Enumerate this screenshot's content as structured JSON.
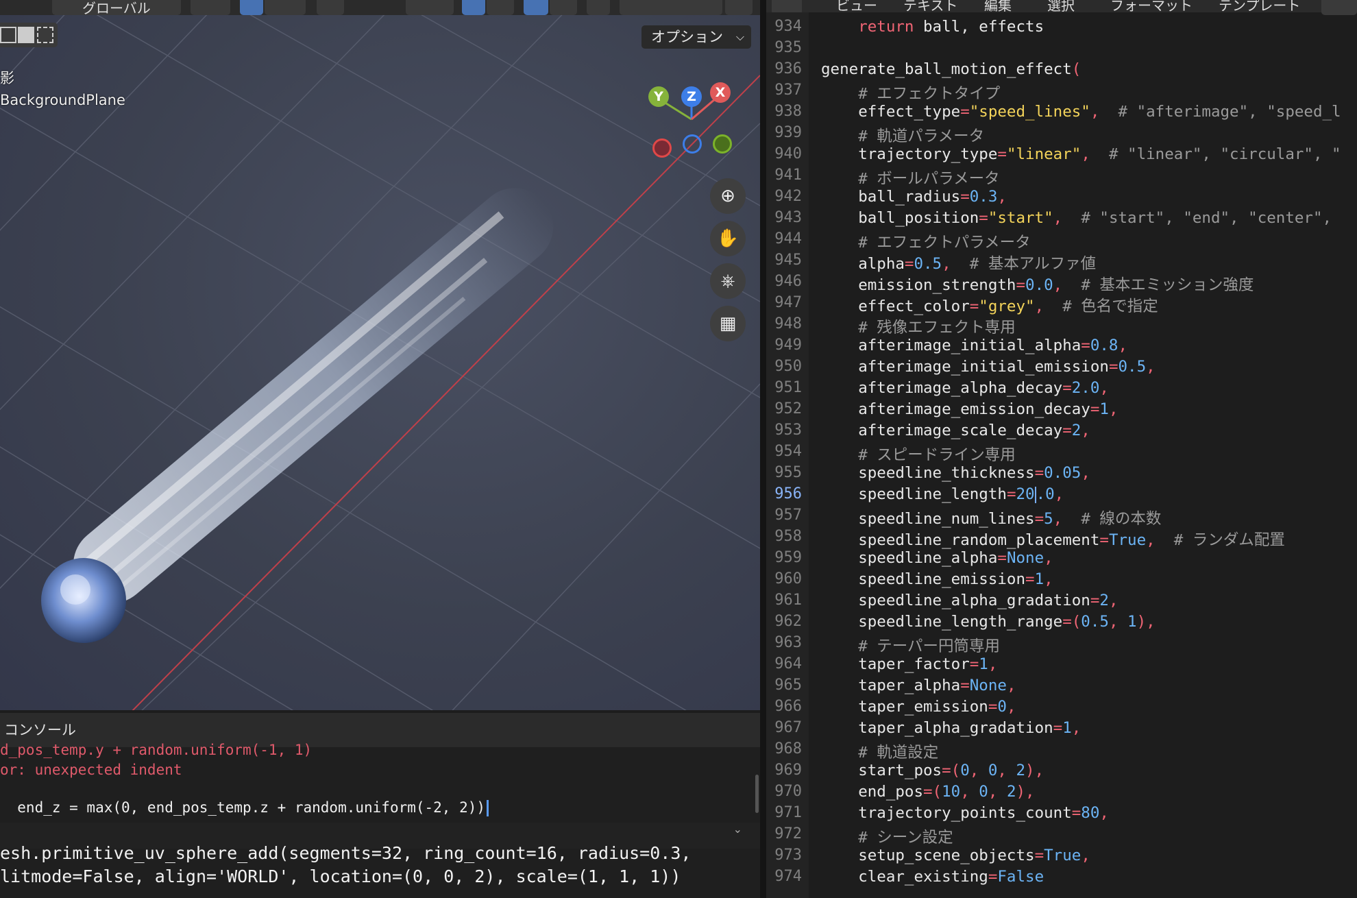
{
  "viewport": {
    "header_mode_label": "グローバル",
    "options_label": "オプション",
    "view_info_line1": "影",
    "view_info_line2": "BackgroundPlane",
    "gizmo": {
      "x": "X",
      "y": "Y",
      "z": "Z"
    },
    "colors": {
      "x_axis": "#e05a5a",
      "y_axis": "#86b33b",
      "z_axis": "#3d7ee8",
      "x_ring": "#e04848",
      "y_ring": "#7cb32a"
    },
    "tools": [
      "zoom-icon",
      "hand-pan-icon",
      "camera-icon",
      "grid-icon"
    ]
  },
  "console": {
    "title": "コンソール",
    "lines": [
      {
        "text": "d_pos_temp.y + random.uniform(-1, 1)",
        "type": "error"
      },
      {
        "text": "or: unexpected indent",
        "type": "error"
      },
      {
        "text": "  end_z = max(0, end_pos_temp.z + random.uniform(-2, 2))",
        "type": "input"
      }
    ],
    "output": [
      "esh.primitive_uv_sphere_add(segments=32, ring_count=16, radius=0.3,",
      "litmode=False, align='WORLD', location=(0, 0, 2), scale=(1, 1, 1))"
    ]
  },
  "editor": {
    "menus": [
      "ビュー",
      "テキスト",
      "編集",
      "選択",
      "フォーマット",
      "テンプレート"
    ],
    "current_line": 956,
    "lines": [
      {
        "n": 934,
        "tokens": [
          [
            "i",
            "    "
          ],
          [
            "kw",
            "return"
          ],
          [
            "t",
            " ball, effects"
          ]
        ]
      },
      {
        "n": 935,
        "tokens": []
      },
      {
        "n": 936,
        "tokens": [
          [
            "t",
            "generate_ball_motion_effect"
          ],
          [
            "op",
            "("
          ]
        ]
      },
      {
        "n": 937,
        "tokens": [
          [
            "i",
            "    "
          ],
          [
            "com",
            "# エフェクトタイプ"
          ]
        ]
      },
      {
        "n": 938,
        "tokens": [
          [
            "i",
            "    "
          ],
          [
            "t",
            "effect_type"
          ],
          [
            "op",
            "="
          ],
          [
            "str",
            "\"speed_lines\""
          ],
          [
            "op",
            ","
          ],
          [
            "t",
            "  "
          ],
          [
            "com",
            "# \"afterimage\", \"speed_l"
          ]
        ]
      },
      {
        "n": 939,
        "tokens": [
          [
            "i",
            "    "
          ],
          [
            "com",
            "# 軌道パラメータ"
          ]
        ]
      },
      {
        "n": 940,
        "tokens": [
          [
            "i",
            "    "
          ],
          [
            "t",
            "trajectory_type"
          ],
          [
            "op",
            "="
          ],
          [
            "str",
            "\"linear\""
          ],
          [
            "op",
            ","
          ],
          [
            "t",
            "  "
          ],
          [
            "com",
            "# \"linear\", \"circular\", \""
          ]
        ]
      },
      {
        "n": 941,
        "tokens": [
          [
            "i",
            "    "
          ],
          [
            "com",
            "# ボールパラメータ"
          ]
        ]
      },
      {
        "n": 942,
        "tokens": [
          [
            "i",
            "    "
          ],
          [
            "t",
            "ball_radius"
          ],
          [
            "op",
            "="
          ],
          [
            "num",
            "0.3"
          ],
          [
            "op",
            ","
          ]
        ]
      },
      {
        "n": 943,
        "tokens": [
          [
            "i",
            "    "
          ],
          [
            "t",
            "ball_position"
          ],
          [
            "op",
            "="
          ],
          [
            "str",
            "\"start\""
          ],
          [
            "op",
            ","
          ],
          [
            "t",
            "  "
          ],
          [
            "com",
            "# \"start\", \"end\", \"center\","
          ]
        ]
      },
      {
        "n": 944,
        "tokens": [
          [
            "i",
            "    "
          ],
          [
            "com",
            "# エフェクトパラメータ"
          ]
        ]
      },
      {
        "n": 945,
        "tokens": [
          [
            "i",
            "    "
          ],
          [
            "t",
            "alpha"
          ],
          [
            "op",
            "="
          ],
          [
            "num",
            "0.5"
          ],
          [
            "op",
            ","
          ],
          [
            "t",
            "  "
          ],
          [
            "com",
            "# 基本アルファ値"
          ]
        ]
      },
      {
        "n": 946,
        "tokens": [
          [
            "i",
            "    "
          ],
          [
            "t",
            "emission_strength"
          ],
          [
            "op",
            "="
          ],
          [
            "num",
            "0.0"
          ],
          [
            "op",
            ","
          ],
          [
            "t",
            "  "
          ],
          [
            "com",
            "# 基本エミッション強度"
          ]
        ]
      },
      {
        "n": 947,
        "tokens": [
          [
            "i",
            "    "
          ],
          [
            "t",
            "effect_color"
          ],
          [
            "op",
            "="
          ],
          [
            "str",
            "\"grey\""
          ],
          [
            "op",
            ","
          ],
          [
            "t",
            "  "
          ],
          [
            "com",
            "# 色名で指定"
          ]
        ]
      },
      {
        "n": 948,
        "tokens": [
          [
            "i",
            "    "
          ],
          [
            "com",
            "# 残像エフェクト専用"
          ]
        ]
      },
      {
        "n": 949,
        "tokens": [
          [
            "i",
            "    "
          ],
          [
            "t",
            "afterimage_initial_alpha"
          ],
          [
            "op",
            "="
          ],
          [
            "num",
            "0.8"
          ],
          [
            "op",
            ","
          ]
        ]
      },
      {
        "n": 950,
        "tokens": [
          [
            "i",
            "    "
          ],
          [
            "t",
            "afterimage_initial_emission"
          ],
          [
            "op",
            "="
          ],
          [
            "num",
            "0.5"
          ],
          [
            "op",
            ","
          ]
        ]
      },
      {
        "n": 951,
        "tokens": [
          [
            "i",
            "    "
          ],
          [
            "t",
            "afterimage_alpha_decay"
          ],
          [
            "op",
            "="
          ],
          [
            "num",
            "2.0"
          ],
          [
            "op",
            ","
          ]
        ]
      },
      {
        "n": 952,
        "tokens": [
          [
            "i",
            "    "
          ],
          [
            "t",
            "afterimage_emission_decay"
          ],
          [
            "op",
            "="
          ],
          [
            "num",
            "1"
          ],
          [
            "op",
            ","
          ]
        ]
      },
      {
        "n": 953,
        "tokens": [
          [
            "i",
            "    "
          ],
          [
            "t",
            "afterimage_scale_decay"
          ],
          [
            "op",
            "="
          ],
          [
            "num",
            "2"
          ],
          [
            "op",
            ","
          ]
        ]
      },
      {
        "n": 954,
        "tokens": [
          [
            "i",
            "    "
          ],
          [
            "com",
            "# スピードライン専用"
          ]
        ]
      },
      {
        "n": 955,
        "tokens": [
          [
            "i",
            "    "
          ],
          [
            "t",
            "speedline_thickness"
          ],
          [
            "op",
            "="
          ],
          [
            "num",
            "0.05"
          ],
          [
            "op",
            ","
          ]
        ]
      },
      {
        "n": 956,
        "tokens": [
          [
            "i",
            "    "
          ],
          [
            "t",
            "speedline_length"
          ],
          [
            "op",
            "="
          ],
          [
            "num",
            "20"
          ],
          [
            "cursor",
            ""
          ],
          [
            "num",
            ".0"
          ],
          [
            "op",
            ","
          ]
        ]
      },
      {
        "n": 957,
        "tokens": [
          [
            "i",
            "    "
          ],
          [
            "t",
            "speedline_num_lines"
          ],
          [
            "op",
            "="
          ],
          [
            "num",
            "5"
          ],
          [
            "op",
            ","
          ],
          [
            "t",
            "  "
          ],
          [
            "com",
            "# 線の本数"
          ]
        ]
      },
      {
        "n": 958,
        "tokens": [
          [
            "i",
            "    "
          ],
          [
            "t",
            "speedline_random_placement"
          ],
          [
            "op",
            "="
          ],
          [
            "num",
            "True"
          ],
          [
            "op",
            ","
          ],
          [
            "t",
            "  "
          ],
          [
            "com",
            "# ランダム配置"
          ]
        ]
      },
      {
        "n": 959,
        "tokens": [
          [
            "i",
            "    "
          ],
          [
            "t",
            "speedline_alpha"
          ],
          [
            "op",
            "="
          ],
          [
            "num",
            "None"
          ],
          [
            "op",
            ","
          ]
        ]
      },
      {
        "n": 960,
        "tokens": [
          [
            "i",
            "    "
          ],
          [
            "t",
            "speedline_emission"
          ],
          [
            "op",
            "="
          ],
          [
            "num",
            "1"
          ],
          [
            "op",
            ","
          ]
        ]
      },
      {
        "n": 961,
        "tokens": [
          [
            "i",
            "    "
          ],
          [
            "t",
            "speedline_alpha_gradation"
          ],
          [
            "op",
            "="
          ],
          [
            "num",
            "2"
          ],
          [
            "op",
            ","
          ]
        ]
      },
      {
        "n": 962,
        "tokens": [
          [
            "i",
            "    "
          ],
          [
            "t",
            "speedline_length_range"
          ],
          [
            "op",
            "=("
          ],
          [
            "num",
            "0.5"
          ],
          [
            "op",
            ", "
          ],
          [
            "num",
            "1"
          ],
          [
            "op",
            "),"
          ]
        ]
      },
      {
        "n": 963,
        "tokens": [
          [
            "i",
            "    "
          ],
          [
            "com",
            "# テーパー円筒専用"
          ]
        ]
      },
      {
        "n": 964,
        "tokens": [
          [
            "i",
            "    "
          ],
          [
            "t",
            "taper_factor"
          ],
          [
            "op",
            "="
          ],
          [
            "num",
            "1"
          ],
          [
            "op",
            ","
          ]
        ]
      },
      {
        "n": 965,
        "tokens": [
          [
            "i",
            "    "
          ],
          [
            "t",
            "taper_alpha"
          ],
          [
            "op",
            "="
          ],
          [
            "num",
            "None"
          ],
          [
            "op",
            ","
          ]
        ]
      },
      {
        "n": 966,
        "tokens": [
          [
            "i",
            "    "
          ],
          [
            "t",
            "taper_emission"
          ],
          [
            "op",
            "="
          ],
          [
            "num",
            "0"
          ],
          [
            "op",
            ","
          ]
        ]
      },
      {
        "n": 967,
        "tokens": [
          [
            "i",
            "    "
          ],
          [
            "t",
            "taper_alpha_gradation"
          ],
          [
            "op",
            "="
          ],
          [
            "num",
            "1"
          ],
          [
            "op",
            ","
          ]
        ]
      },
      {
        "n": 968,
        "tokens": [
          [
            "i",
            "    "
          ],
          [
            "com",
            "# 軌道設定"
          ]
        ]
      },
      {
        "n": 969,
        "tokens": [
          [
            "i",
            "    "
          ],
          [
            "t",
            "start_pos"
          ],
          [
            "op",
            "=("
          ],
          [
            "num",
            "0"
          ],
          [
            "op",
            ", "
          ],
          [
            "num",
            "0"
          ],
          [
            "op",
            ", "
          ],
          [
            "num",
            "2"
          ],
          [
            "op",
            "),"
          ]
        ]
      },
      {
        "n": 970,
        "tokens": [
          [
            "i",
            "    "
          ],
          [
            "t",
            "end_pos"
          ],
          [
            "op",
            "=("
          ],
          [
            "num",
            "10"
          ],
          [
            "op",
            ", "
          ],
          [
            "num",
            "0"
          ],
          [
            "op",
            ", "
          ],
          [
            "num",
            "2"
          ],
          [
            "op",
            "),"
          ]
        ]
      },
      {
        "n": 971,
        "tokens": [
          [
            "i",
            "    "
          ],
          [
            "t",
            "trajectory_points_count"
          ],
          [
            "op",
            "="
          ],
          [
            "num",
            "80"
          ],
          [
            "op",
            ","
          ]
        ]
      },
      {
        "n": 972,
        "tokens": [
          [
            "i",
            "    "
          ],
          [
            "com",
            "# シーン設定"
          ]
        ]
      },
      {
        "n": 973,
        "tokens": [
          [
            "i",
            "    "
          ],
          [
            "t",
            "setup_scene_objects"
          ],
          [
            "op",
            "="
          ],
          [
            "num",
            "True"
          ],
          [
            "op",
            ","
          ]
        ]
      },
      {
        "n": 974,
        "tokens": [
          [
            "i",
            "    "
          ],
          [
            "t",
            "clear_existing"
          ],
          [
            "op",
            "="
          ],
          [
            "num",
            "False"
          ]
        ]
      }
    ],
    "colors": {
      "keyword": "#f06575",
      "string": "#f3d35a",
      "number": "#6cb4f5",
      "comment": "#9a9a9a"
    }
  }
}
